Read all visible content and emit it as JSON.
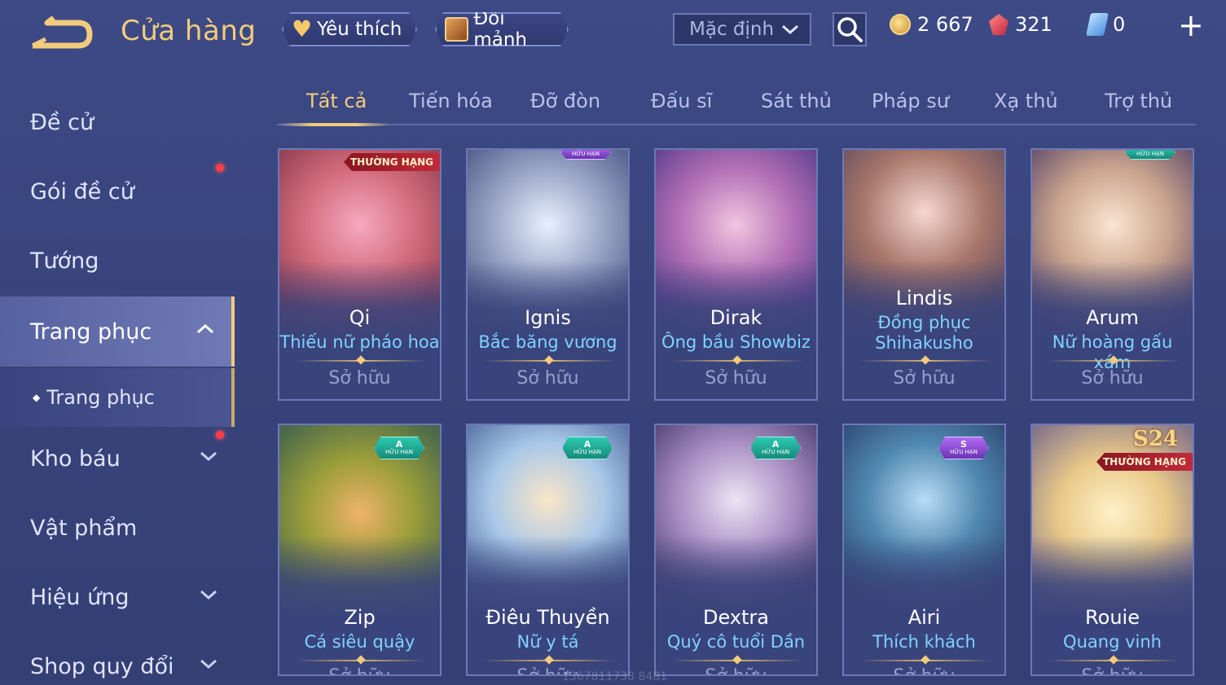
{
  "header": {
    "title": "Cửa hàng",
    "favorites_label": "Yêu thích",
    "exchange_label": "Đổi mảnh",
    "sort_value": "Mặc định",
    "currencies": {
      "gold": "2 667",
      "ruby": "321",
      "voucher": "0"
    },
    "plus": "+"
  },
  "sidebar": {
    "items": [
      {
        "label": "Đề cử"
      },
      {
        "label": "Gói đề cử"
      },
      {
        "label": "Tướng"
      },
      {
        "label": "Trang phục"
      },
      {
        "label": "Trang phục"
      },
      {
        "label": "Kho báu"
      },
      {
        "label": "Vật phẩm"
      },
      {
        "label": "Hiệu ứng"
      },
      {
        "label": "Shop quy đổi"
      }
    ]
  },
  "tabs": [
    "Tất cả",
    "Tiến hóa",
    "Đỡ đòn",
    "Đấu sĩ",
    "Sát thủ",
    "Pháp sư",
    "Xạ thủ",
    "Trợ thủ"
  ],
  "cards": [
    {
      "hero": "Qi",
      "skin": "Thiếu nữ pháo hoa",
      "status": "Sở hữu",
      "badge": "THƯỜNG HẠNG"
    },
    {
      "hero": "Ignis",
      "skin": "Bắc băng vương",
      "status": "Sở hữu",
      "badge": "HỮU HẠN"
    },
    {
      "hero": "Dirak",
      "skin": "Ông bầu Showbiz",
      "status": "Sở hữu"
    },
    {
      "hero": "Lindis",
      "skin": "Đồng phục",
      "skin2": "Shihakusho",
      "status": "Sở hữu"
    },
    {
      "hero": "Arum",
      "skin": "Nữ hoàng gấu xám",
      "status": "Sở hữu",
      "badge": "HỮU HẠN"
    },
    {
      "hero": "Zip",
      "skin": "Cá siêu quậy",
      "status": "Sở hữu",
      "grade": "A",
      "badge": "HỮU HẠN"
    },
    {
      "hero": "Điêu Thuyền",
      "skin": "Nữ y tá",
      "status": "Sở hữu",
      "grade": "A",
      "badge": "HỮU HẠN"
    },
    {
      "hero": "Dextra",
      "skin": "Quý cô tuổi Dần",
      "status": "Sở hữu",
      "grade": "A",
      "badge": "HỮU HẠN"
    },
    {
      "hero": "Airi",
      "skin": "Thích khách",
      "status": "Sở hữu",
      "grade": "S",
      "badge": "HỮU HẠN"
    },
    {
      "hero": "Rouie",
      "skin": "Quang vinh",
      "status": "Sở hữu",
      "season": "S24",
      "badge": "THƯỜNG HẠNG"
    }
  ],
  "watermark": "1367811738 8481",
  "colors": {
    "accent_gold": "#f2cc7c",
    "skin_name_blue": "#7fd3ff",
    "background": "#3b4783",
    "notification_red": "#ff3b45"
  },
  "icons": [
    "back-arrow-icon",
    "heart-icon",
    "chest-icon",
    "chevron-down-icon",
    "search-icon",
    "gold-coin-icon",
    "ruby-icon",
    "voucher-icon",
    "plus-icon",
    "chevron-up-icon",
    "diamond-bullet-icon"
  ]
}
